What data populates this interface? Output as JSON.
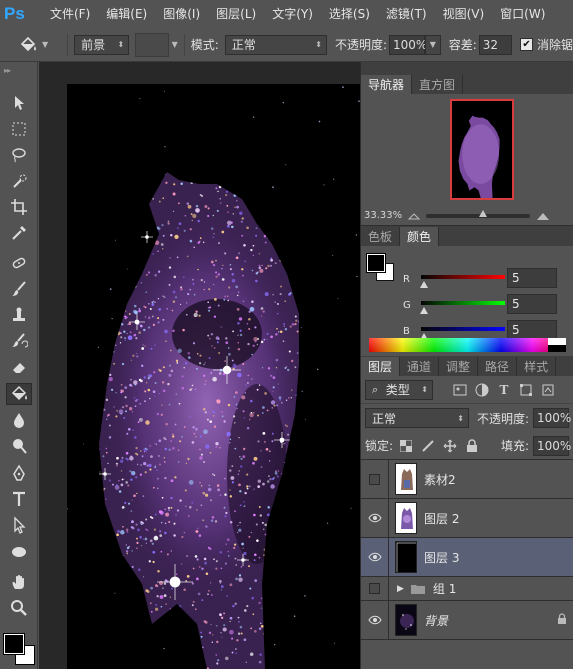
{
  "app": {
    "logo": "Ps"
  },
  "menu": [
    "文件(F)",
    "编辑(E)",
    "图像(I)",
    "图层(L)",
    "文字(Y)",
    "选择(S)",
    "滤镜(T)",
    "视图(V)",
    "窗口(W)"
  ],
  "options": {
    "fill_source": "前景",
    "mode_label": "模式:",
    "mode_value": "正常",
    "opacity_label": "不透明度:",
    "opacity_value": "100%",
    "tolerance_label": "容差:",
    "tolerance_value": "32",
    "antialias_label": "消除锯",
    "antialias_checked": true
  },
  "tools": [
    "move-tool",
    "marquee-tool",
    "lasso-tool",
    "quick-select-tool",
    "crop-tool",
    "eyedropper-tool",
    "healing-brush-tool",
    "brush-tool",
    "clone-stamp-tool",
    "history-brush-tool",
    "eraser-tool",
    "paint-bucket-tool",
    "blur-tool",
    "dodge-tool",
    "pen-tool",
    "type-tool",
    "path-select-tool",
    "ellipse-tool",
    "hand-tool",
    "zoom-tool"
  ],
  "active_tool": "paint-bucket-tool",
  "navigator": {
    "tabs": [
      "导航器",
      "直方图"
    ],
    "zoom": "33.33%",
    "zoom_level": 0.55
  },
  "color_panel": {
    "tabs": [
      "色板",
      "颜色"
    ],
    "r_label": "R",
    "r_value": "5",
    "g_label": "G",
    "g_value": "5",
    "b_label": "B",
    "b_value": "5"
  },
  "layers_panel": {
    "tabs": [
      "图层",
      "通道",
      "调整",
      "路径",
      "样式"
    ],
    "filter_label": "类型",
    "blend_mode": "正常",
    "opacity_label": "不透明度:",
    "opacity_value": "100%",
    "lock_label": "锁定:",
    "fill_label": "填充:",
    "fill_value": "100%",
    "layers": [
      {
        "name": "素材2",
        "visible": false,
        "selected": false
      },
      {
        "name": "图层 2",
        "visible": true,
        "selected": false
      },
      {
        "name": "图层 3",
        "visible": true,
        "selected": true
      },
      {
        "name": "组 1",
        "visible": false,
        "selected": false,
        "group": true
      },
      {
        "name": "背景",
        "visible": true,
        "selected": false,
        "locked": true
      }
    ]
  },
  "colors": {
    "ui_bg": "#535353",
    "canvas_bg": "#000000",
    "nav_frame": "#d93c3c",
    "selected_layer": "#5a6075",
    "ps_blue": "#31a8ff"
  }
}
